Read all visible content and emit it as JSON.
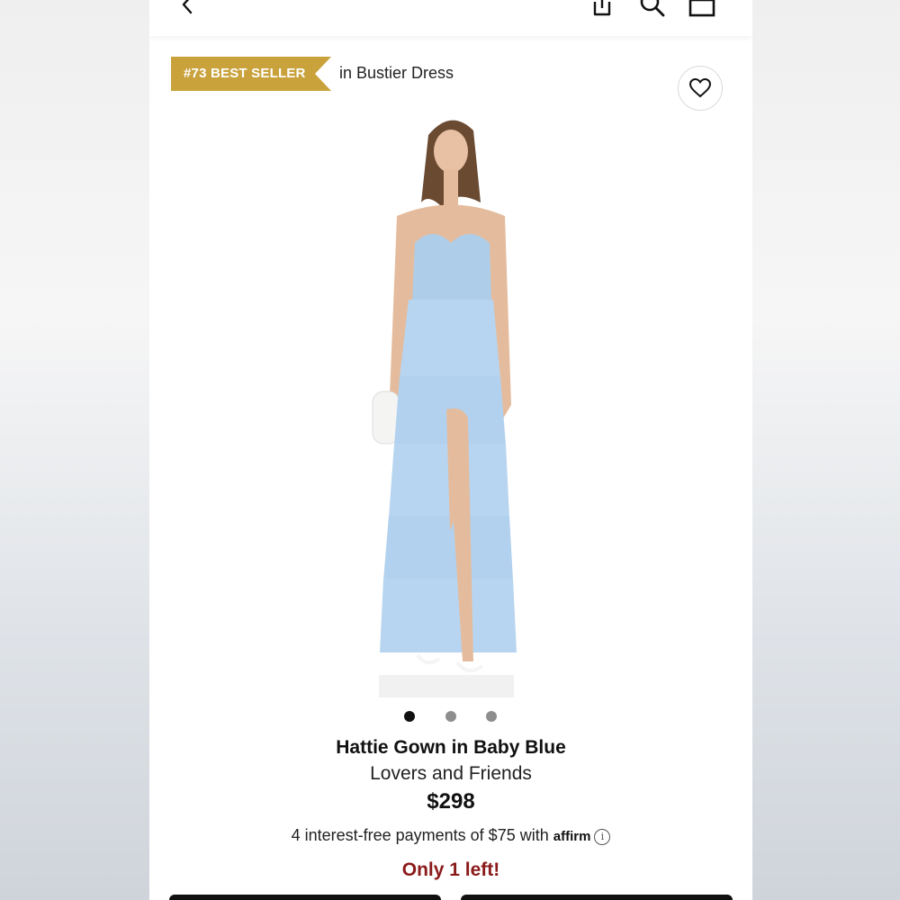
{
  "nav": {
    "back_icon": "chevron-left-icon",
    "share_icon": "share-icon",
    "search_icon": "search-icon",
    "bag_icon": "shopping-bag-icon"
  },
  "badge": {
    "label": "#73 BEST SELLER",
    "suffix": "in Bustier Dress",
    "color": "#c9a23c"
  },
  "wishlist": {
    "icon": "heart-icon"
  },
  "product": {
    "dress_color": "#b7d5f0",
    "title": "Hattie Gown in Baby Blue",
    "brand": "Lovers and Friends",
    "price": "$298",
    "installments_text": "4 interest-free payments of $75 with ",
    "affirm_label": "affirm",
    "info_icon": "i",
    "stock_message": "Only 1 left!",
    "stock_color": "#8b1a1a"
  },
  "carousel": {
    "count": 3,
    "active_index": 0
  }
}
